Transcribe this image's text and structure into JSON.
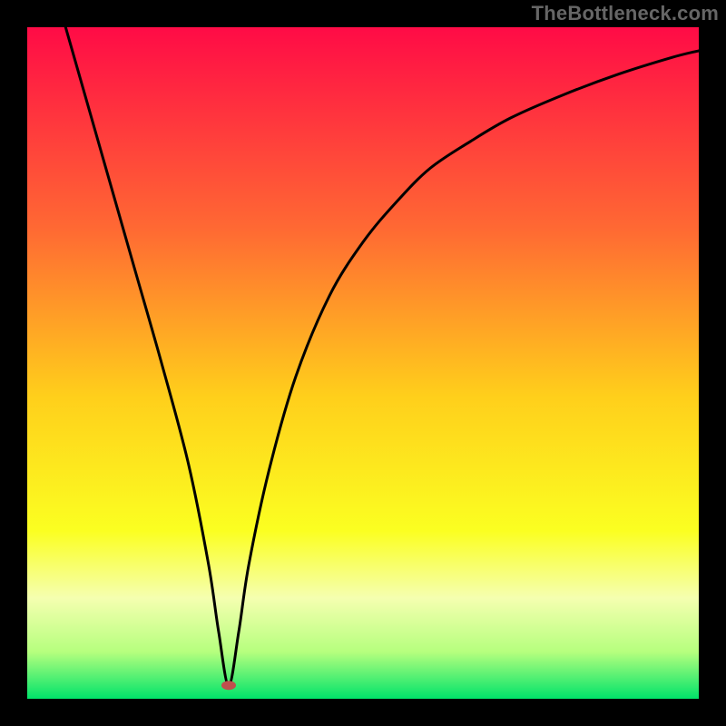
{
  "watermark": "TheBottleneck.com",
  "chart_data": {
    "type": "line",
    "title": "",
    "xlabel": "",
    "ylabel": "",
    "xlim": [
      0,
      100
    ],
    "ylim": [
      0,
      100
    ],
    "minimum_marker": {
      "x": 30,
      "y": 2,
      "color": "#c0504d"
    },
    "background_gradient": [
      {
        "stop": 0,
        "color": "#ff0b46"
      },
      {
        "stop": 30,
        "color": "#ff6933"
      },
      {
        "stop": 55,
        "color": "#ffcf1b"
      },
      {
        "stop": 75,
        "color": "#fbff21"
      },
      {
        "stop": 85,
        "color": "#f5ffb0"
      },
      {
        "stop": 93,
        "color": "#b6ff7e"
      },
      {
        "stop": 100,
        "color": "#00e36a"
      }
    ],
    "series": [
      {
        "name": "bottleneck-curve",
        "color": "#000000",
        "x": [
          4,
          8,
          12,
          16,
          20,
          24,
          27,
          28.5,
          30,
          31.5,
          33,
          36,
          40,
          45,
          50,
          55,
          60,
          66,
          72,
          80,
          88,
          96,
          100
        ],
        "y": [
          106,
          92,
          78,
          64,
          50,
          35,
          20,
          10,
          2,
          10,
          20,
          34,
          48,
          60,
          68,
          74,
          79,
          83,
          86.5,
          90,
          93,
          95.5,
          96.5
        ]
      }
    ]
  }
}
